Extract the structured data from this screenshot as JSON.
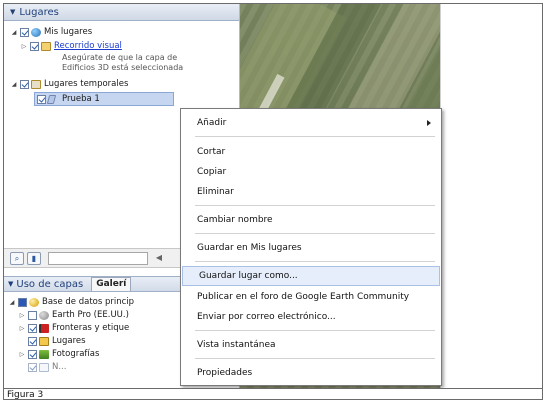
{
  "places_panel": {
    "header": "Lugares",
    "my_places": "Mis lugares",
    "sightseeing": "Recorrido visual",
    "sightseeing_desc": [
      "Asegúrate de que la capa de",
      "Edificios 3D está seleccionada"
    ],
    "temporary_places": "Lugares temporales",
    "selected_item": "Prueba 1"
  },
  "layers_panel": {
    "header": "Uso de capas",
    "tab_gallery": "Galerí",
    "items": [
      "Base de datos princip",
      "Earth Pro (EE.UU.)",
      "Fronteras y etique",
      "Lugares",
      "Fotografías",
      "N..."
    ]
  },
  "context_menu": {
    "items": [
      {
        "label": "Añadir",
        "submenu": true
      },
      {
        "label": "Cortar"
      },
      {
        "label": "Copiar"
      },
      {
        "label": "Eliminar"
      },
      {
        "label": "Cambiar nombre"
      },
      {
        "label": "Guardar en Mis lugares"
      },
      {
        "label": "Guardar lugar como..."
      },
      {
        "label": "Publicar en el foro de Google Earth Community"
      },
      {
        "label": "Enviar por correo electrónico..."
      },
      {
        "label": "Vista instantánea"
      },
      {
        "label": "Propiedades"
      }
    ],
    "hovered_index": 6
  },
  "caption": "Figura 3",
  "colors": {
    "accent": "#1b3ccf",
    "selection": "#c6d6f1",
    "menu_hover": "#e6eefb"
  }
}
